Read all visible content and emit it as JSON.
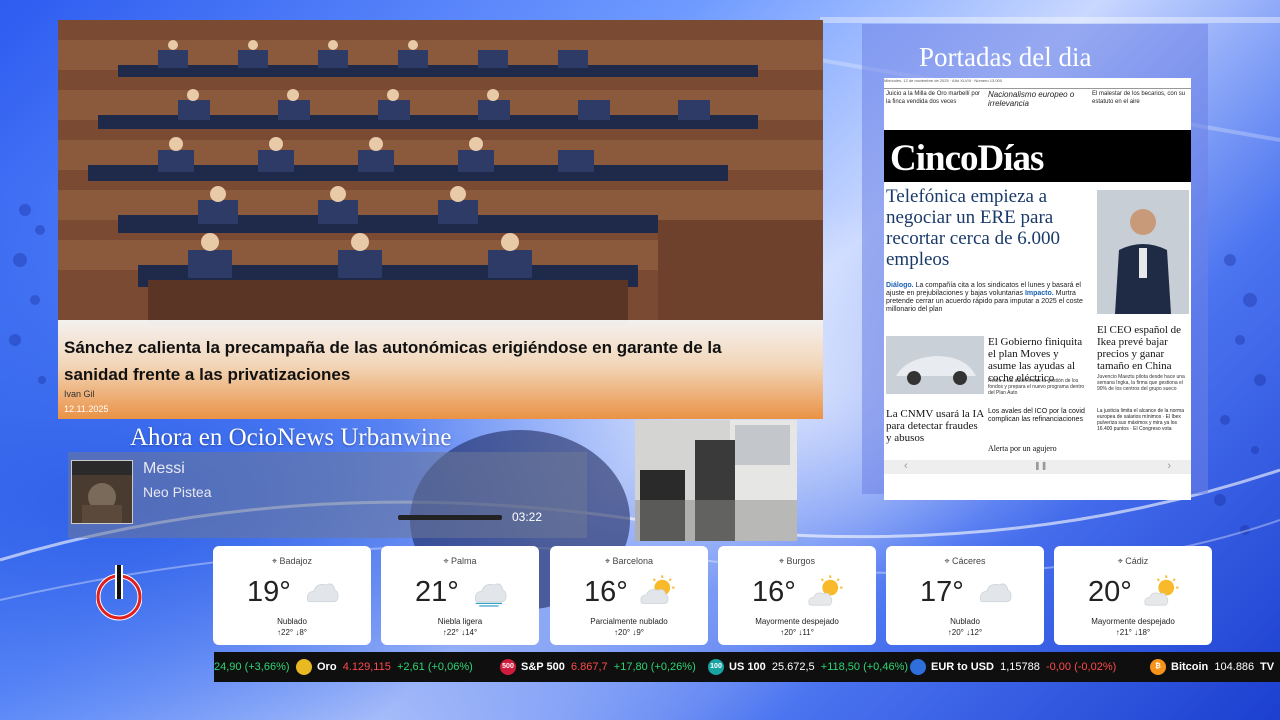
{
  "news": {
    "title": "Sánchez calienta la precampaña de las autonómicas erigiéndose en garante de la sanidad frente a las privatizaciones",
    "author": "Ivan Gil",
    "date": "12.11.2025"
  },
  "now_playing": {
    "heading": "Ahora en OcioNews Urbanwine",
    "track": "Messi",
    "artist": "Neo Pistea",
    "time": "03:22",
    "progress": 1.0
  },
  "portadas": {
    "title": "Portadas del dia",
    "paper": {
      "masthead": "CincoDías",
      "top_strip": "Miércoles, 12 de noviembre de 2025 · Año XLVIII · Número 13.000",
      "teasers": [
        "Juicio a la Milla de Oro marbellí por la finca vendida dos veces",
        "Nacionalismo europeo o irrelevancia",
        "El malestar de los becarios, con su estatuto en el aire"
      ],
      "headline": "Telefónica empieza a negociar un ERE para recortar cerca de 6.000 empleos",
      "lede_1_label": "Diálogo.",
      "lede_1": " La compañía cita a los sindicatos el lunes y basará el ajuste en prejubilaciones y bajas voluntarias",
      "lede_2_label": "Impacto.",
      "lede_2": " Murtra pretende cerrar un acuerdo rápido para imputar a 2025 el coste millonario del plan",
      "ikea": "El CEO español de Ikea prevé bajar precios y ganar tamaño en China",
      "ikea_sub": "Juvencio Maeztu pilota desde hace una semana Ingka, la firma que gestiona el 90% de los centros del grupo sueco",
      "moves": "El Gobierno finiquita el plan Moves y asume las ayudas al coche eléctrico",
      "moves_sub": "Retira a las autonomías la gestión de los fondos y prepara el nuevo programa dentro del Plan Auto",
      "cnmv": "La CNMV usará la IA para detectar fraudes y abusos",
      "ico": "Los avales del ICO por la covid complican las refinanciaciones",
      "alerta": "Alerta por un agujero",
      "small_col": "La justicia limita el alcance de la norma europea de salarios mínimos · El Ibex pulveriza sus máximos y mira ya los 16.400 puntos · El Congreso vota"
    }
  },
  "weather": [
    {
      "city": "Badajoz",
      "temp": "19°",
      "condition": "Nublado",
      "range": "↑22°  ↓8°",
      "icon": "cloud-icon"
    },
    {
      "city": "Palma",
      "temp": "21°",
      "condition": "Niebla ligera",
      "range": "↑22°  ↓14°",
      "icon": "fog-icon"
    },
    {
      "city": "Barcelona",
      "temp": "16°",
      "condition": "Parcialmente nublado",
      "range": "↑20°  ↓9°",
      "icon": "partly-cloudy-icon"
    },
    {
      "city": "Burgos",
      "temp": "16°",
      "condition": "Mayormente despejado",
      "range": "↑20°  ↓11°",
      "icon": "mostly-sunny-icon"
    },
    {
      "city": "Cáceres",
      "temp": "17°",
      "condition": "Nublado",
      "range": "↑20°  ↓12°",
      "icon": "cloud-icon"
    },
    {
      "city": "Cádiz",
      "temp": "20°",
      "condition": "Mayormente despejado",
      "range": "↑21°  ↓18°",
      "icon": "mostly-sunny-icon"
    }
  ],
  "ticker": {
    "lead_change": "24,90 (+3,66%)",
    "items": [
      {
        "name": "Oro",
        "price": "4.129,115",
        "change": "+2,61 (+0,06%)",
        "direction": "up",
        "badge_color": "#e8b923"
      },
      {
        "name": "S&P 500",
        "price": "6.867,7",
        "change": "+17,80 (+0,26%)",
        "direction": "up",
        "badge_color": "#d01c3c",
        "badge": "500"
      },
      {
        "name": "US 100",
        "price": "25.672,5",
        "change": "+118,50 (+0,46%)",
        "direction": "up",
        "badge_color": "#1aa3a3",
        "badge": "100"
      },
      {
        "name": "EUR to USD",
        "price": "1,15788",
        "change": "-0,00 (-0,02%)",
        "direction": "down",
        "badge_color": "#2f6fdc"
      },
      {
        "name": "Bitcoin",
        "price": "104.886",
        "change": "",
        "direction": "",
        "badge_color": "#f7931a",
        "badge": "₿"
      }
    ],
    "tv_badge": "TV"
  }
}
